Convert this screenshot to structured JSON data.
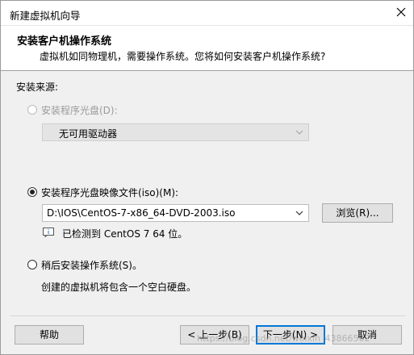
{
  "window": {
    "title": "新建虚拟机向导"
  },
  "header": {
    "title": "安装客户机操作系统",
    "subtitle": "虚拟机如同物理机，需要操作系统。您将如何安装客户机操作系统?"
  },
  "source": {
    "label": "安装来源:",
    "options": [
      {
        "label": "安装程序光盘(D):",
        "selected": false,
        "enabled": false,
        "dropdown_value": "无可用驱动器"
      },
      {
        "label": "安装程序光盘映像文件(iso)(M):",
        "selected": true,
        "enabled": true,
        "path_value": "D:\\IOS\\CentOS-7-x86_64-DVD-2003.iso",
        "browse_label": "浏览(R)...",
        "detected_text": "已检测到 CentOS 7 64 位。"
      },
      {
        "label": "稍后安装操作系统(S)。",
        "selected": false,
        "enabled": true,
        "description": "创建的虚拟机将包含一个空白硬盘。"
      }
    ]
  },
  "footer": {
    "help_label": "帮助",
    "back_label": "< 上一步(B)",
    "next_label": "下一步(N) >",
    "cancel_label": "取消"
  },
  "watermark": "https://blog.csdn.net/weixin_43866562",
  "colors": {
    "accent": "#0078d7",
    "background": "#f0f0f0",
    "header_bg": "#ffffff"
  }
}
